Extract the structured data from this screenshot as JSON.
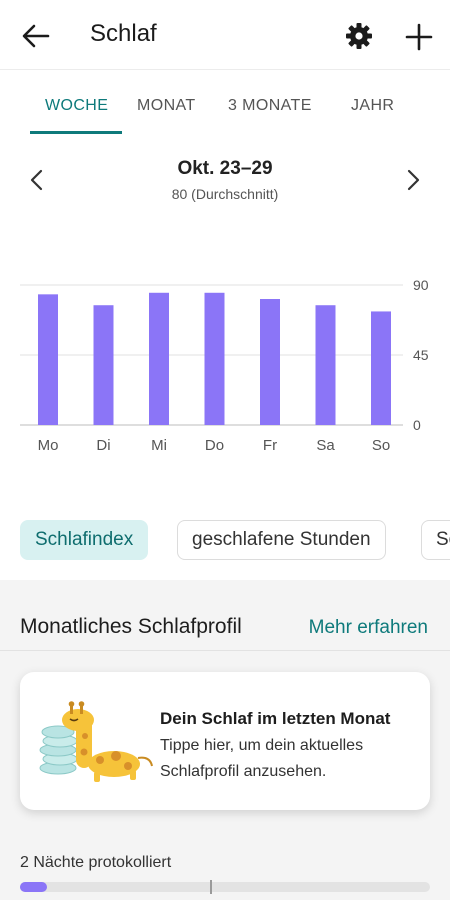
{
  "header": {
    "title": "Schlaf",
    "icons": [
      "back-arrow-icon",
      "gear-icon",
      "plus-icon"
    ]
  },
  "tabs": [
    {
      "label": "WOCHE",
      "active": true
    },
    {
      "label": "MONAT",
      "active": false
    },
    {
      "label": "3 MONATE",
      "active": false
    },
    {
      "label": "JAHR",
      "active": false
    }
  ],
  "period": {
    "range": "Okt. 23–29",
    "average": "80 (Durchschnitt)"
  },
  "chart_data": {
    "type": "bar",
    "categories": [
      "Mo",
      "Di",
      "Mi",
      "Do",
      "Fr",
      "Sa",
      "So"
    ],
    "values": [
      84,
      77,
      85,
      85,
      81,
      77,
      73
    ],
    "yticks": [
      "90",
      "45",
      "0"
    ],
    "ylim": [
      0,
      90
    ],
    "grid": true,
    "color": "#8b75f7"
  },
  "chips": [
    {
      "label": "Schlafindex",
      "active": true
    },
    {
      "label": "geschlafene Stunden",
      "active": false
    },
    {
      "label": "Sc",
      "active": false
    }
  ],
  "profile": {
    "heading": "Monatliches Schlafprofil",
    "link": "Mehr erfahren",
    "card_title": "Dein Schlaf im letzten Monat",
    "card_text": "Tippe hier, um dein aktuelles Schlafprofil anzusehen."
  },
  "progress": {
    "label": "2 Nächte protokolliert",
    "nights_logged": 2,
    "fill_fraction": 0.065
  },
  "colors": {
    "accent": "#0e7a7b",
    "bar": "#8b75f7",
    "chip_active_bg": "#d8f1f1"
  }
}
